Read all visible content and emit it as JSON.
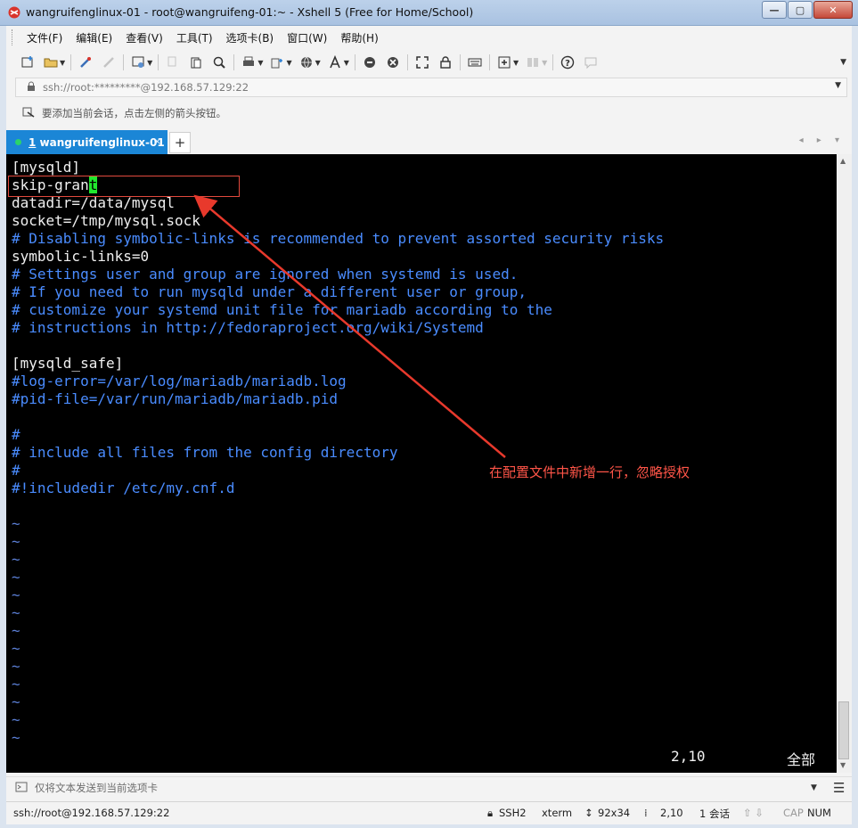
{
  "window": {
    "title": "wangruifenglinux-01 - root@wangruifeng-01:~ - Xshell 5 (Free for Home/School)",
    "minimize_label": "—",
    "maximize_label": "▢",
    "close_label": "✕"
  },
  "menu": [
    {
      "label": "文件(F)"
    },
    {
      "label": "编辑(E)"
    },
    {
      "label": "查看(V)"
    },
    {
      "label": "工具(T)"
    },
    {
      "label": "选项卡(B)"
    },
    {
      "label": "窗口(W)"
    },
    {
      "label": "帮助(H)"
    }
  ],
  "toolbar": {
    "icons": [
      "new-session-icon",
      "open-folder-icon",
      "reconnect-icon",
      "disconnect-icon",
      "properties-icon",
      "copy-icon",
      "paste-icon",
      "find-icon",
      "print-icon",
      "transfer-icon",
      "globe-icon",
      "font-icon",
      "xftp-icon",
      "xmanager-icon",
      "fullscreen-icon",
      "lock-icon",
      "keyboard-icon",
      "add-pane-icon",
      "layout-icon",
      "help-icon",
      "chat-icon"
    ]
  },
  "address": {
    "value": "ssh://root:*********@192.168.57.129:22"
  },
  "hint": {
    "text": "要添加当前会话，点击左侧的箭头按钮。"
  },
  "tabs": {
    "active": {
      "number": "1",
      "label": "wangruifenglinux-01",
      "close_label": "×"
    },
    "add_label": "+",
    "nav_label": "◂ ▸ ▾"
  },
  "terminal": {
    "lines": [
      {
        "text": "[mysqld]",
        "kind": "plain"
      },
      {
        "text": "skip-gran",
        "cursor": "t",
        "kind": "plain"
      },
      {
        "text": "datadir=/data/mysql",
        "kind": "plain"
      },
      {
        "text": "socket=/tmp/mysql.sock",
        "kind": "plain"
      },
      {
        "text": "# Disabling symbolic-links is recommended to prevent assorted security risks",
        "kind": "comment"
      },
      {
        "text": "symbolic-links=0",
        "kind": "plain"
      },
      {
        "text": "# Settings user and group are ignored when systemd is used.",
        "kind": "comment"
      },
      {
        "text": "# If you need to run mysqld under a different user or group,",
        "kind": "comment"
      },
      {
        "text": "# customize your systemd unit file for mariadb according to the",
        "kind": "comment"
      },
      {
        "text": "# instructions in http://fedoraproject.org/wiki/Systemd",
        "kind": "comment"
      },
      {
        "text": "",
        "kind": "plain"
      },
      {
        "text": "[mysqld_safe]",
        "kind": "plain"
      },
      {
        "text": "#log-error=/var/log/mariadb/mariadb.log",
        "kind": "comment"
      },
      {
        "text": "#pid-file=/var/run/mariadb/mariadb.pid",
        "kind": "comment"
      },
      {
        "text": "",
        "kind": "plain"
      },
      {
        "text": "#",
        "kind": "comment"
      },
      {
        "text": "# include all files from the config directory",
        "kind": "comment"
      },
      {
        "text": "#",
        "kind": "comment"
      },
      {
        "text": "#!includedir /etc/my.cnf.d",
        "kind": "comment"
      },
      {
        "text": "",
        "kind": "plain"
      },
      {
        "text": "~",
        "kind": "tilde"
      },
      {
        "text": "~",
        "kind": "tilde"
      },
      {
        "text": "~",
        "kind": "tilde"
      },
      {
        "text": "~",
        "kind": "tilde"
      },
      {
        "text": "~",
        "kind": "tilde"
      },
      {
        "text": "~",
        "kind": "tilde"
      },
      {
        "text": "~",
        "kind": "tilde"
      },
      {
        "text": "~",
        "kind": "tilde"
      },
      {
        "text": "~",
        "kind": "tilde"
      },
      {
        "text": "~",
        "kind": "tilde"
      },
      {
        "text": "~",
        "kind": "tilde"
      },
      {
        "text": "~",
        "kind": "tilde"
      },
      {
        "text": "~",
        "kind": "tilde"
      }
    ],
    "cursor_position": "2,10",
    "scope": "全部",
    "annotation": "在配置文件中新增一行，忽略授权"
  },
  "send_bar": {
    "placeholder": "仅将文本发送到当前选项卡"
  },
  "status": {
    "connection": "ssh://root@192.168.57.129:22",
    "protocol": "SSH2",
    "terminal_type": "xterm",
    "size": "92x34",
    "cursor": "2,10",
    "sessions": "1 会话",
    "cap": "CAP",
    "num": "NUM"
  },
  "colors": {
    "tab_active": "#1b86d6",
    "terminal_bg": "#000000",
    "comment": "#4a8cff",
    "cursor": "#22e82e",
    "annotation": "#ff5548"
  }
}
